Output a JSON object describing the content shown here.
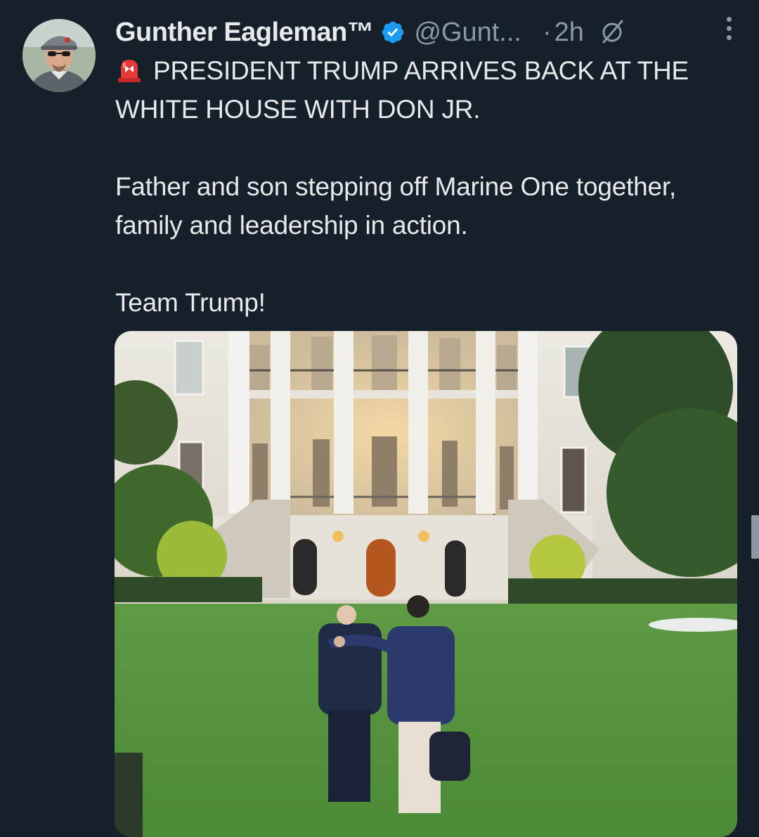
{
  "author": {
    "name": "Gunther Eagleman™",
    "handle": "@Gunt...",
    "separator": "·",
    "time": "2h",
    "verified": true
  },
  "tweet": {
    "line1": "PRESIDENT TRUMP ARRIVES BACK AT THE WHITE HOUSE WITH DON JR.",
    "line2": "Father and son stepping off Marine One together, family and leadership in action.",
    "line3": "Team Trump!"
  },
  "icons": {
    "avatar": "avatar-photo",
    "verified": "verified-badge-icon",
    "grok": "grok-icon",
    "more": "more-options-icon",
    "siren": "siren-emoji-icon"
  },
  "colors": {
    "background": "#15202b",
    "text": "#e7e9ea",
    "secondary": "#8b98a5",
    "verified": "#1d9bf0"
  }
}
